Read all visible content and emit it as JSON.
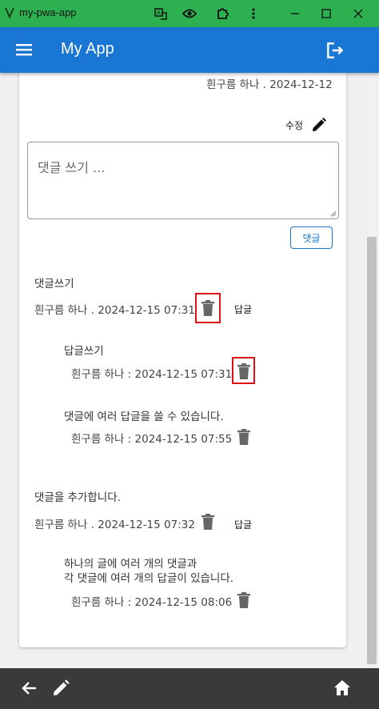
{
  "window": {
    "title": "my-pwa-app"
  },
  "appbar": {
    "title": "My App"
  },
  "post": {
    "author_date": "흰구름 하나 . 2024-12-12",
    "edit_label": "수정"
  },
  "comment_form": {
    "placeholder": "댓글 쓰기 ...",
    "submit_label": "댓글"
  },
  "comments": [
    {
      "text": "댓글쓰기",
      "meta": "흰구름 하나 . 2024-12-15 07:31",
      "reply_label": "답글",
      "replies": [
        {
          "text": "답글쓰기",
          "meta": "흰구름 하나 : 2024-12-15 07:31"
        },
        {
          "text": "댓글에 여러 답글을 쓸 수 있습니다.",
          "meta": "흰구름 하나 : 2024-12-15 07:55"
        }
      ]
    },
    {
      "text": "댓글을 추가합니다.",
      "meta": "흰구름 하나 . 2024-12-15 07:32",
      "reply_label": "답글",
      "replies": [
        {
          "text_line1": "하나의 글에 여러 개의 댓글과",
          "text_line2": "각 댓글에 여러 개의 답글이 있습니다.",
          "meta": "흰구름 하나 : 2024-12-15 08:06"
        }
      ]
    }
  ],
  "icons": {
    "menu": "menu-icon",
    "logout": "logout-icon",
    "edit": "pencil-icon",
    "delete": "trash-icon",
    "back": "arrow-left-icon",
    "write": "pencil-icon",
    "home": "home-icon"
  },
  "colors": {
    "titlebar": "#2db04f",
    "appbar": "#1976d2",
    "bottombar": "#3a3a3a",
    "highlight": "#e01010"
  }
}
